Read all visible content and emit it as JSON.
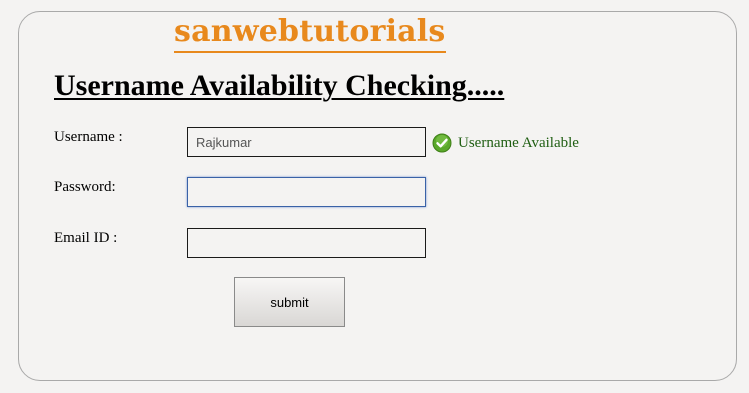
{
  "brand": {
    "name": "sanwebtutorials"
  },
  "page": {
    "title": "Username Availability Checking....."
  },
  "form": {
    "username": {
      "label": "Username :",
      "value": "Rajkumar"
    },
    "password": {
      "label": "Password:",
      "value": ""
    },
    "email": {
      "label": "Email ID :",
      "value": ""
    },
    "availability": {
      "text": "Username Available",
      "icon": "check-circle-icon",
      "color": "#1f5e12"
    },
    "submit_label": "submit"
  },
  "colors": {
    "brand": "#e8891d",
    "focus": "#3a62a7",
    "success": "#4a9a1c"
  }
}
